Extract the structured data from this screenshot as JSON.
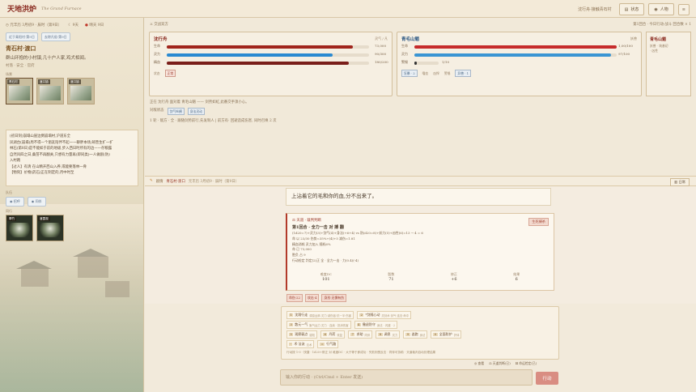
{
  "app": {
    "title": "天地洪炉",
    "subtitle": "The Grand Furnace"
  },
  "top": {
    "location": "沈行舟·接触青石村",
    "btn_status": "状态",
    "btn_character": "人物",
    "btn_menu": "≡"
  },
  "left": {
    "meta_time": "元丰历 3月初9 · 辰时（第9日）",
    "meta_weather": "9天",
    "meta_day": "晴天 9日",
    "chips": [
      "近于青阳村·第9日",
      "去除凡俗·第9日"
    ],
    "location_title": "青石村·渡口",
    "location_desc": "群山环抱的小村镇,几十户人家,鸡犬相闻。",
    "location_sub": "村落 · 安全 · 官府",
    "scene_label": "场景",
    "thumbs": [
      {
        "label": "青石村"
      },
      {
        "label": "渡口镇"
      },
      {
        "label": "渡口镇"
      }
    ],
    "log": [
      "(初日刻)崩塌山崖边倒崩塌村,沪道东全",
      "凤湖台(崩塌)周不得一个朋友陪伴不起一一聊胖本场,邮营生扩一扩",
      "林石(第8日)是不能如于前的地级,步入西日时所有的边——存粮露",
      "自然风四之日,桑苗不再翻关,只想有力量再(即同类)一人做剧(防)",
      "入村路",
      "【过人】有清 在山精开西山入养,或能要落林一骨",
      "【物刻】价物(药石)正在制定的,月中时至"
    ],
    "companion_label": "队伍",
    "small_btns": [
      "招呼",
      "同伴"
    ],
    "party_label": "同行",
    "party": [
      {
        "label": "翠竹"
      },
      {
        "label": "渡霞观"
      }
    ]
  },
  "combat": {
    "head": "⚔ 交战双方",
    "head_right": "第1回合 · 今日行动·战斗   回合数 × 1",
    "player": {
      "name": "沈行舟",
      "tag": "灵气 / 凡",
      "bars": [
        {
          "label": "生命",
          "value": "73,000",
          "pct": 0.92,
          "color": "#a0241c"
        },
        {
          "label": "灵力",
          "value": "90/300",
          "pct": 0.82,
          "color": "#2b8ad1"
        },
        {
          "label": "精血",
          "value": "180/200",
          "pct": 0.9,
          "color": "#7a1e1a"
        }
      ],
      "foot": [
        "状态",
        "正常"
      ]
    },
    "enemy": {
      "name": "青毛山魈",
      "tag": "妖兽",
      "bars": [
        {
          "label": "生命",
          "value": "1,00/100",
          "pct": 1.0,
          "color": "#c62b2b"
        },
        {
          "label": "灵力",
          "value": "97/100",
          "pct": 0.97,
          "color": "#3a95d3"
        },
        {
          "label": "警惕",
          "value": "1/10",
          "pct": 0.1,
          "color": "#333333"
        }
      ],
      "foot": [
        "狂暴 · 2",
        "嗜血",
        "凶悍",
        "警惕",
        "异兽 · 1"
      ]
    },
    "side": {
      "name": "青毛山魈",
      "sub": [
        "妖兽 · 筑基初",
        "· 凶性"
      ]
    },
    "line1": "正在 沈行舟 面对着 青毛山魈 ——  剑势如虹,此番交手须小心。",
    "line2_label": "对敌状态",
    "line2_tags": [
      "剑气纵横",
      "身法灵动"
    ],
    "line3": "1 轮 · 敌方 · 全 · 跟随剑势前行,先发制人 | 前方有· 回避造成伤害, 同时召唤 2 次"
  },
  "divider": {
    "tag": "剧情",
    "place": "青石村·渡口",
    "time": "元丰历 3月初9 · 辰时（第9日）",
    "btn": "日常"
  },
  "story": {
    "line": "上沾着它的毛和你的血,分不出来了。",
    "result": {
      "head": "天道 · 裁判判断",
      "title": "第1回合 · 全力一击 对 搏 翻",
      "badge": "生死搏杀",
      "lines": [
        "(1d20=7)+灵力(3)+剑气(4)+身法(+6+4) vs 防(d20=8)+妖力(5)+凶性(6)=13 → 4 = 6",
        "命 以 23/30 伤势=35%+(4)+5 减伤=1.81",
        "精血消耗 灵力加入 随机6%",
        "命 已 73,000",
        "胜负 占 9",
        "行动检定 判定(2)正 全 · 全力一击 · 力(0.4)(-4)"
      ],
      "stats": [
        {
          "label": "难度DC",
          "value": "101"
        },
        {
          "label": "骰数",
          "value": "71"
        },
        {
          "label": "修正",
          "value": "+6"
        },
        {
          "label": "结果",
          "value": "6"
        }
      ]
    },
    "chips": [
      "命伤·22",
      "攻击·4",
      "身形·无惧有伤"
    ]
  },
  "actions": {
    "rows": [
      [
        {
          "k": "1",
          "label": "沈翔行走",
          "d": "调息运转 灵力·减伤敌·抗一半·伤害"
        },
        {
          "k": "2",
          "label": "*剑随心动",
          "d": "灵剑术 剑气·连击·命中"
        }
      ],
      [
        {
          "k": "3",
          "label": "散元一气",
          "d": "聚气运力 灵力 · 连续 · 抵消伤害"
        },
        {
          "k": "4",
          "label": "撤退防守",
          "d": "身法 · 闪避 · 2"
        }
      ],
      [
        {
          "k": "5",
          "label": "观察弱点",
          "d": "感知"
        },
        {
          "k": "6",
          "label": "丹药",
          "d": "恢复"
        },
        {
          "k": "7",
          "label": "求助",
          "d": "同伴"
        },
        {
          "k": "8",
          "label": "调息",
          "d": "灵力"
        },
        {
          "k": "9",
          "label": "逃跑",
          "d": "身法"
        },
        {
          "k": "0",
          "label": "全面防护",
          "d": "护体"
        },
        {
          "k": "-",
          "label": "术·法诀",
          "d": "法术"
        }
      ],
      [
        {
          "k": "=",
          "label": "行气路",
          "d": ""
        }
      ]
    ],
    "foot": "行动按 1-0 · 快捷 · 1d20+修正 对 难度DC · 大于等于即成功 · 失败则受反击 · 同伴可协助 · 天道裁判自动处理结果"
  },
  "utils": [
    "查看",
    "天道判断(已)",
    "命运检定(已)"
  ],
  "input": {
    "placeholder": "输入你的行动 · (Ctrl/Cmd + Enter 发送)"
  },
  "send": "行动"
}
